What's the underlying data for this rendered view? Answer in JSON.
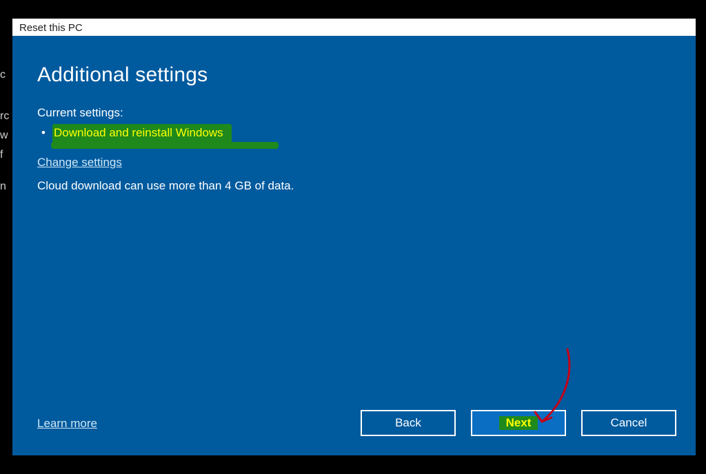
{
  "background_fragments": {
    "a": "c",
    "b": "rc",
    "c": "w",
    "d": "f",
    "e": "n"
  },
  "dialog": {
    "title": "Reset this PC",
    "heading": "Additional settings",
    "current_settings_label": "Current settings:",
    "settings": [
      "Download and reinstall Windows"
    ],
    "change_settings_link": "Change settings",
    "info_text": "Cloud download can use more than 4 GB of data.",
    "learn_more_link": "Learn more",
    "buttons": {
      "back": "Back",
      "next": "Next",
      "cancel": "Cancel"
    }
  },
  "annotations": {
    "highlight_color": "#1f8a1b",
    "highlight_text_color": "#ffff00",
    "arrow_color": "#c40018"
  }
}
